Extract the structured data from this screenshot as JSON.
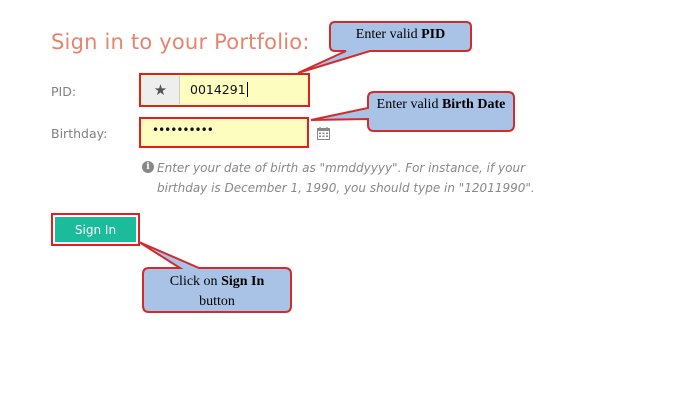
{
  "page": {
    "title": "Sign in to your Portfolio:"
  },
  "form": {
    "pid_label": "PID:",
    "pid_value": "0014291",
    "birthday_label": "Birthday:",
    "birthday_value": "••••••••••",
    "help_text_line1": "Enter your date of birth as \"mmddyyyy\". For instance, if your",
    "help_text_line2": "birthday is December 1, 1990, you should type in \"12011990\".",
    "signin_label": "Sign In"
  },
  "icons": {
    "pid_addon": "star-icon",
    "birthday_addon": "calendar-icon",
    "help": "info-circle-icon"
  },
  "callouts": {
    "pid_prefix": "Enter valid ",
    "pid_bold": "PID",
    "birth_prefix": "Enter valid ",
    "birth_bold": "Birth Date",
    "signin_prefix": "Click on ",
    "signin_bold": "Sign In",
    "signin_suffix": "button"
  },
  "colors": {
    "title": "#e8846e",
    "highlight_border": "#e02020",
    "input_bg": "#fdfdc0",
    "button_bg": "#1bbc9b",
    "callout_fill": "#a9c3e6",
    "callout_border": "#d32b2b"
  }
}
